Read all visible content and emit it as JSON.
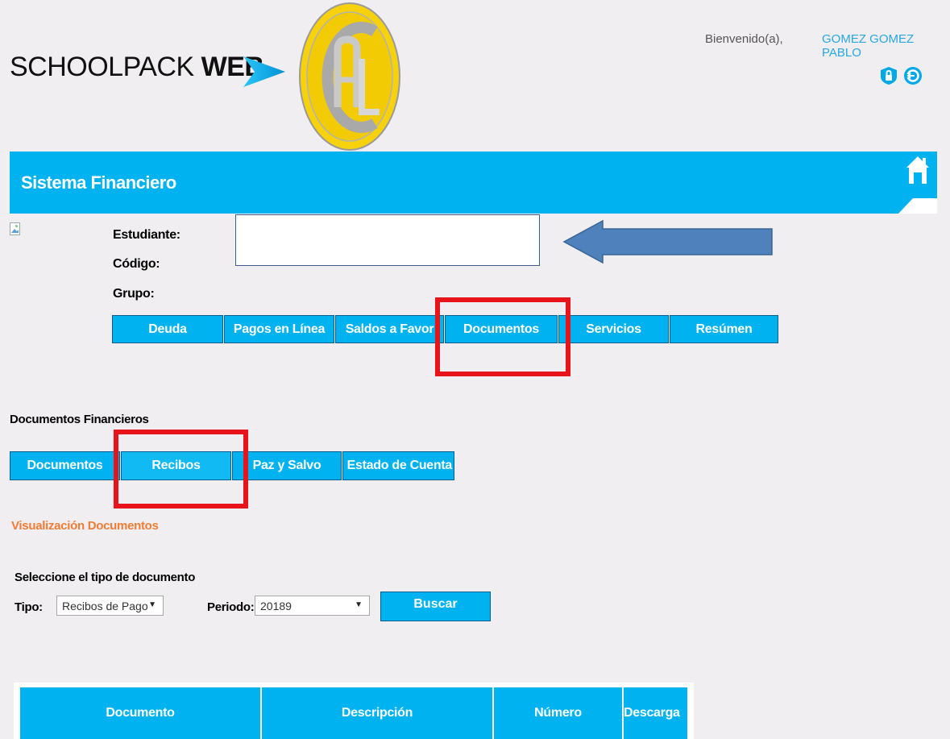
{
  "brand": {
    "name_regular": "SCHOOLPACK ",
    "name_bold": "WEB",
    "emblem_letters": "AC"
  },
  "user": {
    "welcome": "Bienvenido(a),",
    "name": "GOMEZ GOMEZ PABLO"
  },
  "icons": {
    "lock": "lock-shield-icon",
    "logout": "logout-icon",
    "home": "home-icon"
  },
  "header": {
    "title": "Sistema Financiero"
  },
  "student": {
    "label_student": "Estudiante:",
    "label_code": "Código:",
    "label_group": "Grupo:"
  },
  "main_tabs": [
    "Deuda",
    "Pagos en Línea",
    "Saldos a Favor",
    "Documentos",
    "Servicios",
    "Resúmen"
  ],
  "section": {
    "title": "Documentos Financieros"
  },
  "sub_tabs": [
    "Documentos",
    "Recibos",
    "Paz y Salvo",
    "Estado de Cuenta"
  ],
  "visualization": {
    "title": "Visualización Documentos"
  },
  "filters": {
    "prompt": "Seleccione el tipo de documento",
    "type_label": "Tipo:",
    "type_value": "Recibos de Pago",
    "period_label": "Periodo:",
    "period_value": "20189",
    "search_button": "Buscar"
  },
  "table": {
    "columns": [
      "Documento",
      "Descripción",
      "Número",
      "Descarga"
    ]
  },
  "colors": {
    "accent": "#00b3f0",
    "highlight": "#e8141c",
    "arrow": "#4f81bd",
    "orange": "#f07c34"
  }
}
